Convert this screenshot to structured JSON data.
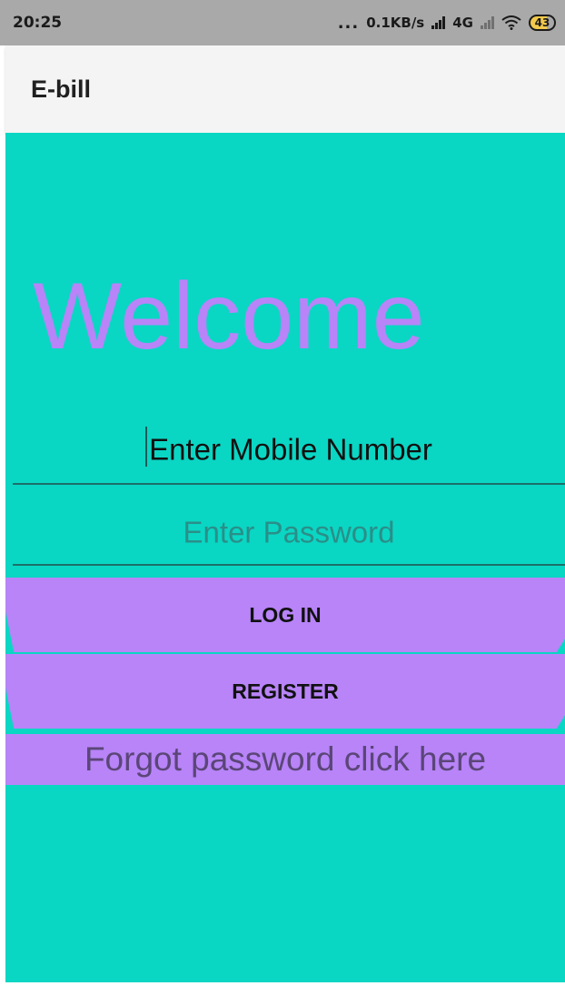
{
  "status_bar": {
    "time": "20:25",
    "dots": "...",
    "network_speed": "0.1KB/s",
    "network_type": "4G",
    "battery": "43"
  },
  "app_bar": {
    "title": "E-bill"
  },
  "main": {
    "welcome": "Welcome",
    "mobile_field": {
      "value": "Enter Mobile Number"
    },
    "password_field": {
      "placeholder": "Enter Password"
    },
    "login_label": "LOG IN",
    "register_label": "REGISTER",
    "forgot_label": "Forgot password click here"
  },
  "colors": {
    "background": "#0ad6c4",
    "accent": "#b884f8",
    "app_bar": "#f4f4f4",
    "status_bar": "#a9a9a9"
  }
}
